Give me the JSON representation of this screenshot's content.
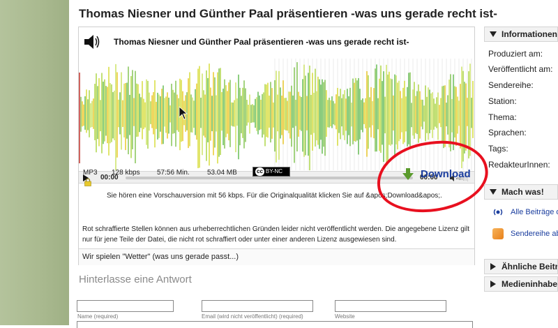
{
  "page": {
    "title": "Thomas Niesner und Günther Paal präsentieren -was uns gerade recht ist-"
  },
  "player": {
    "title": "Thomas Niesner und Günther Paal präsentieren -was uns gerade recht ist-",
    "time_current": "00:00",
    "time_end": "00:00",
    "format": "MP3",
    "bitrate": "128 kbps",
    "duration": "57:56 Min.",
    "filesize": "53.04 MB",
    "license_badge": "BY-NC",
    "download_label": "Download",
    "preview_note": "Sie hören eine Vorschauversion mit 56 kbps. Für die Originalqualität klicken Sie auf &apos;Download&apos;.",
    "red_note": "Rot schraffierte Stellen können aus urheberrechtlichen Gründen leider nicht veröffentlicht werden. Die angegebene Lizenz gilt nur für jene Teile der Datei, die nicht rot schraffiert oder unter einer anderen Lizenz ausgewiesen sind.",
    "now_playing": "Wir spielen \"Wetter\" (was uns gerade passt...)",
    "waveform_colors": [
      "#7cc04a",
      "#a7d23c",
      "#d4da2e",
      "#e8c41c",
      "#5cb84a",
      "#c9e05a"
    ]
  },
  "reply": {
    "heading": "Hinterlasse eine Antwort",
    "name_label": "Name (required)",
    "email_label": "Email (wird nicht veröffentlicht) (required)",
    "website_label": "Website"
  },
  "sidebar": {
    "info_heading": "Informationen",
    "info_items": [
      "Produziert am:",
      "Veröffentlicht am:",
      "Sendereihe:",
      "Station:",
      "Thema:",
      "Sprachen:",
      "Tags:",
      "RedakteurInnen:"
    ],
    "mach_heading": "Mach was!",
    "link_all": "Alle Beiträge o",
    "link_series": "Sendereihe ab",
    "similar_heading": "Ähnliche Beiträ",
    "media_heading": "Medieninhaber"
  },
  "annotation": {
    "highlight_color": "#e8101f"
  }
}
